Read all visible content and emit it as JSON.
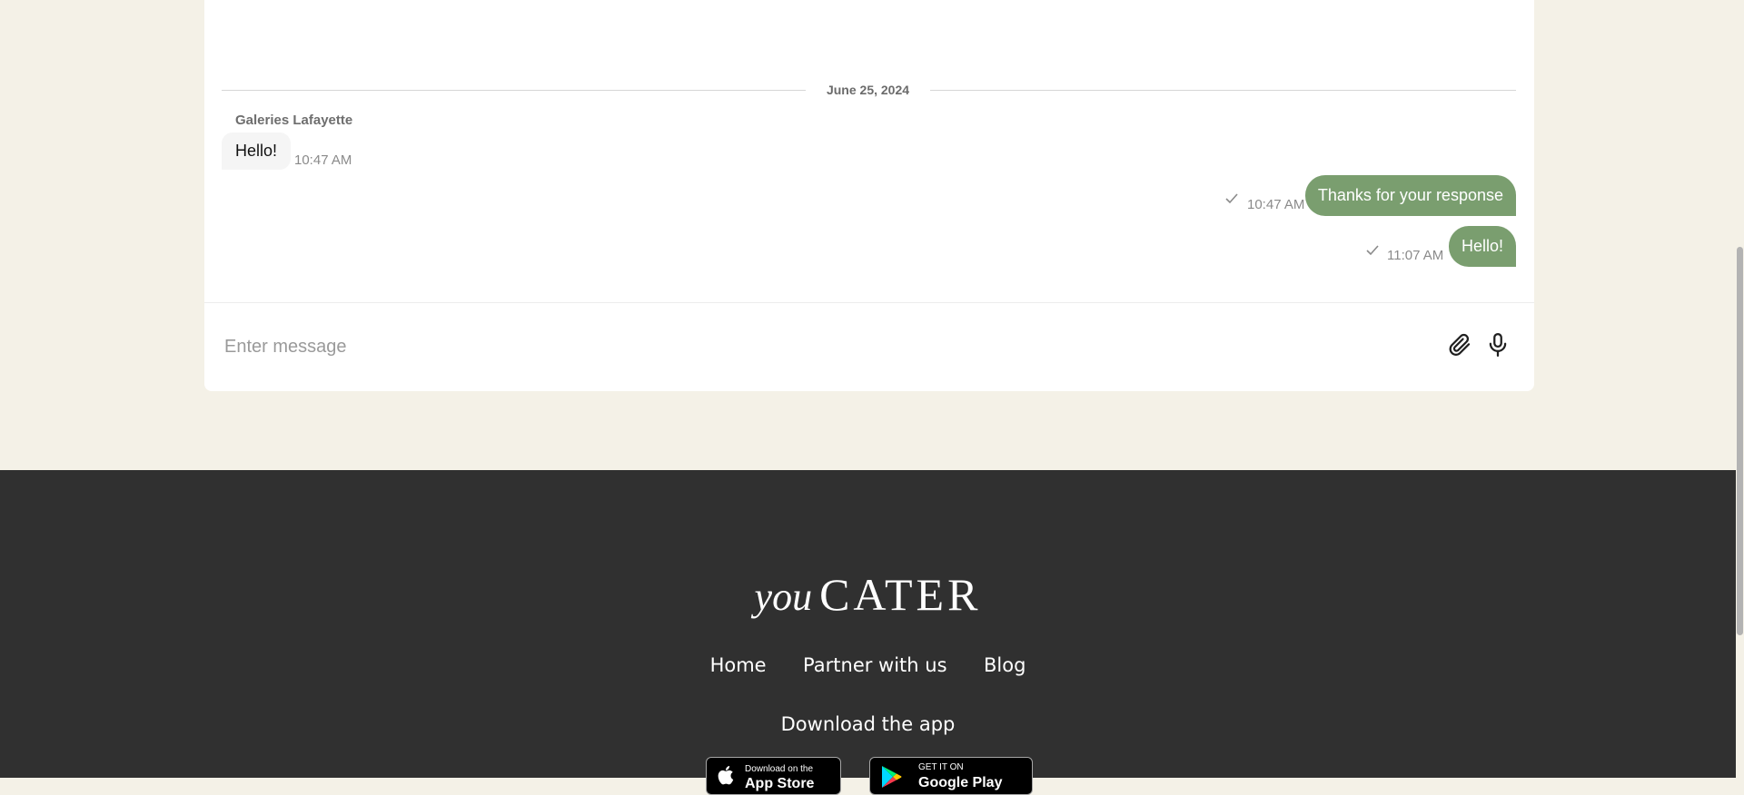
{
  "chat": {
    "date_separator": "June 25, 2024",
    "sender_name": "Galeries Lafayette",
    "incoming": {
      "text": "Hello!",
      "time": "10:47 AM"
    },
    "outgoing": [
      {
        "text": "Thanks for your response",
        "time": "10:47 AM",
        "status": "check-icon"
      },
      {
        "text": "Hello!",
        "time": "11:07 AM",
        "status": "check-icon"
      }
    ],
    "input_placeholder": "Enter message",
    "attach_icon": "paperclip-icon",
    "mic_icon": "microphone-icon",
    "colors": {
      "outgoing_bubble": "#7a9e6f",
      "incoming_bubble": "#f5f5f5"
    }
  },
  "footer": {
    "logo_script": "you",
    "logo_main": "CATER",
    "nav": [
      "Home",
      "Partner with us",
      "Blog"
    ],
    "download_title": "Download the app",
    "app_store": {
      "small": "Download on the",
      "big": "App Store"
    },
    "google_play": {
      "small": "GET IT ON",
      "big": "Google Play"
    },
    "background": "#303030"
  },
  "page": {
    "background": "#f4f1e7"
  }
}
